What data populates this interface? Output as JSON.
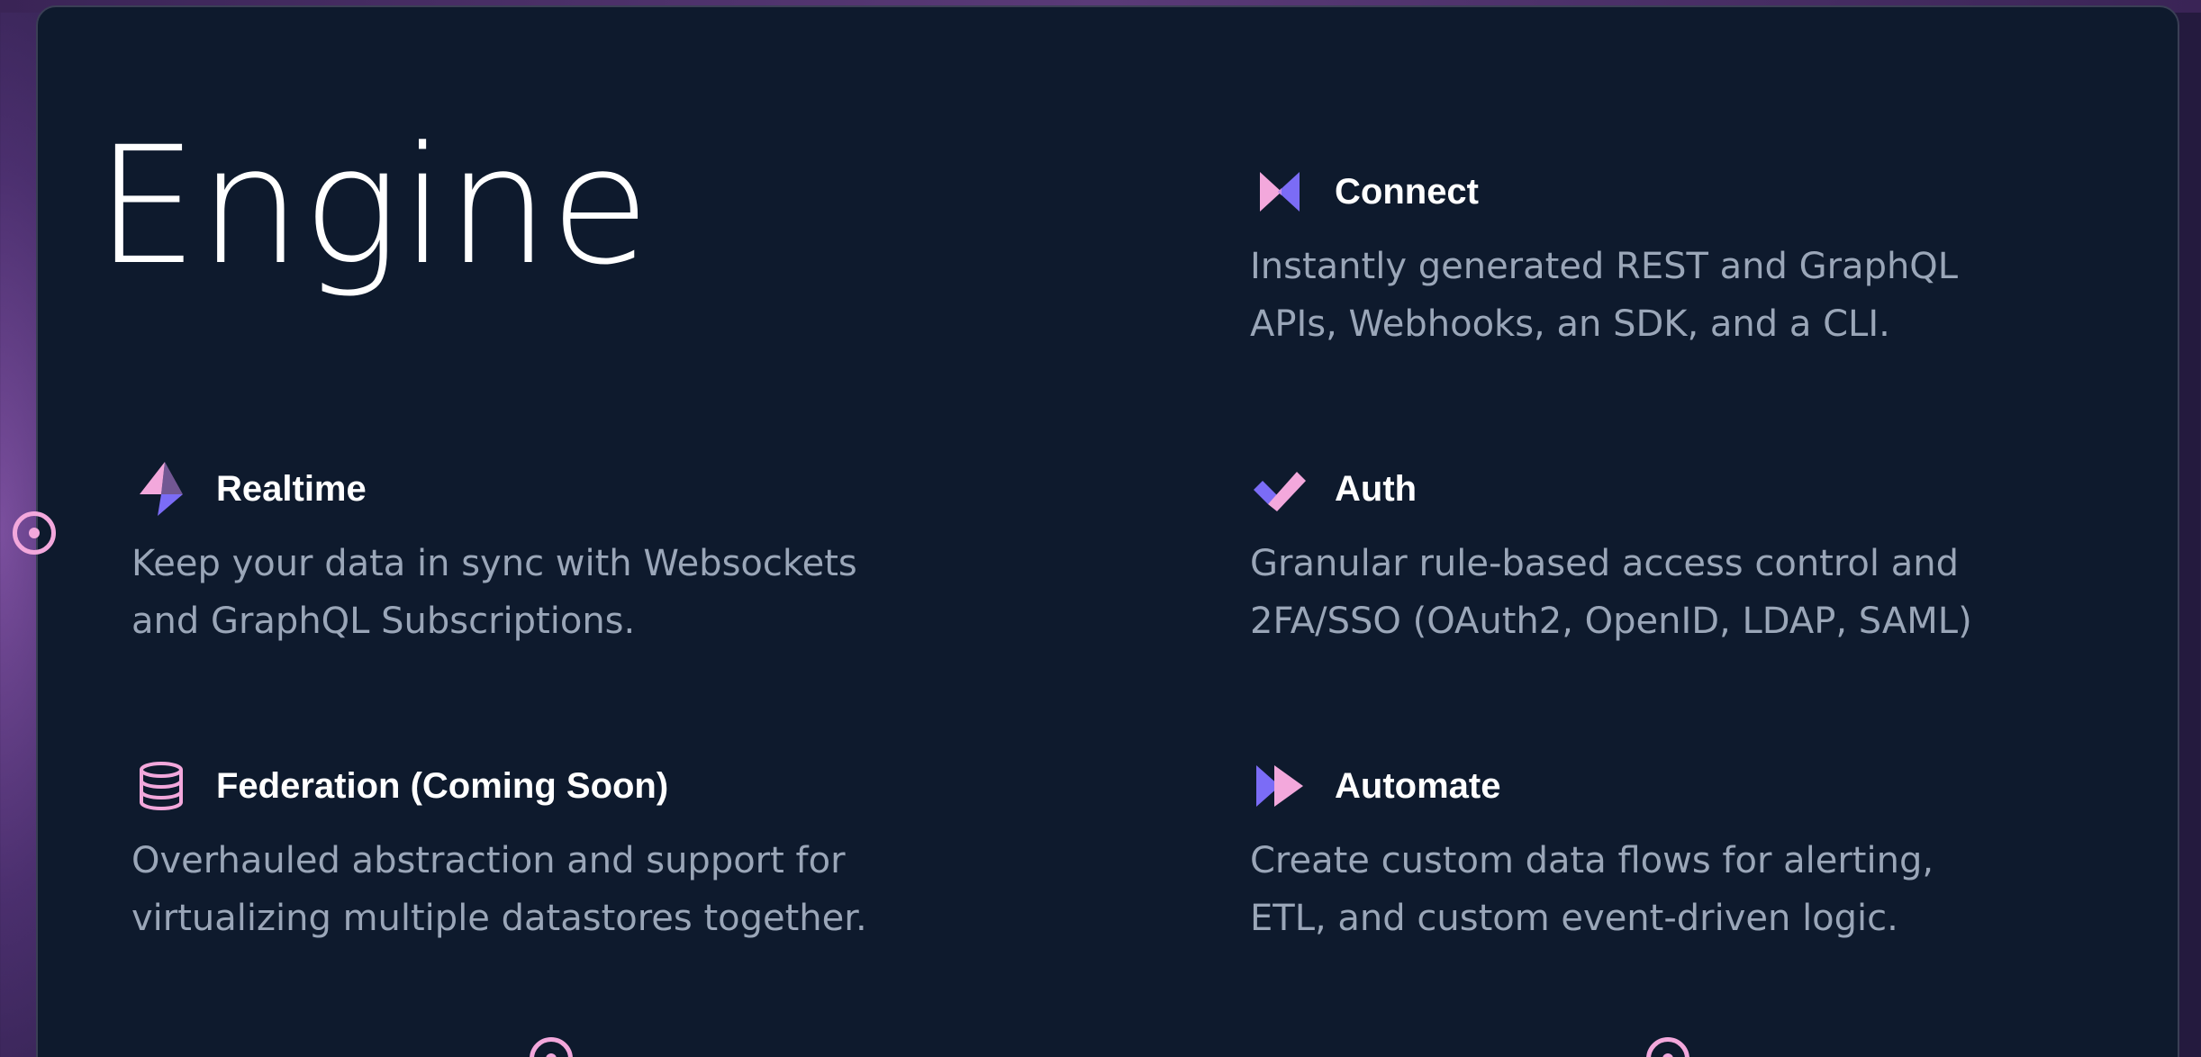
{
  "title": "Engine",
  "features": [
    {
      "icon": "connect-icon",
      "title": "Connect",
      "description": "Instantly generated REST and GraphQL\nAPIs, Webhooks, an SDK, and a CLI."
    },
    {
      "icon": "lightning-icon",
      "title": "Realtime",
      "description": "Keep your data in sync with Websockets\nand GraphQL Subscriptions."
    },
    {
      "icon": "checkmark-icon",
      "title": "Auth",
      "description": "Granular rule-based access control and\n2FA/SSO (OAuth2, OpenID, LDAP, SAML)"
    },
    {
      "icon": "database-icon",
      "title": "Federation (Coming Soon)",
      "description": "Overhauled abstraction and support for\nvirtualizing multiple datastores together."
    },
    {
      "icon": "fast-forward-icon",
      "title": "Automate",
      "description": "Create custom data flows for alerting,\nETL, and custom event-driven logic."
    }
  ],
  "colors": {
    "card_background": "#0e1a2d",
    "accent_pink": "#f3a8dc",
    "accent_purple": "#7b6cf6",
    "text_primary": "#ffffff",
    "text_secondary": "#9aa6b8"
  }
}
